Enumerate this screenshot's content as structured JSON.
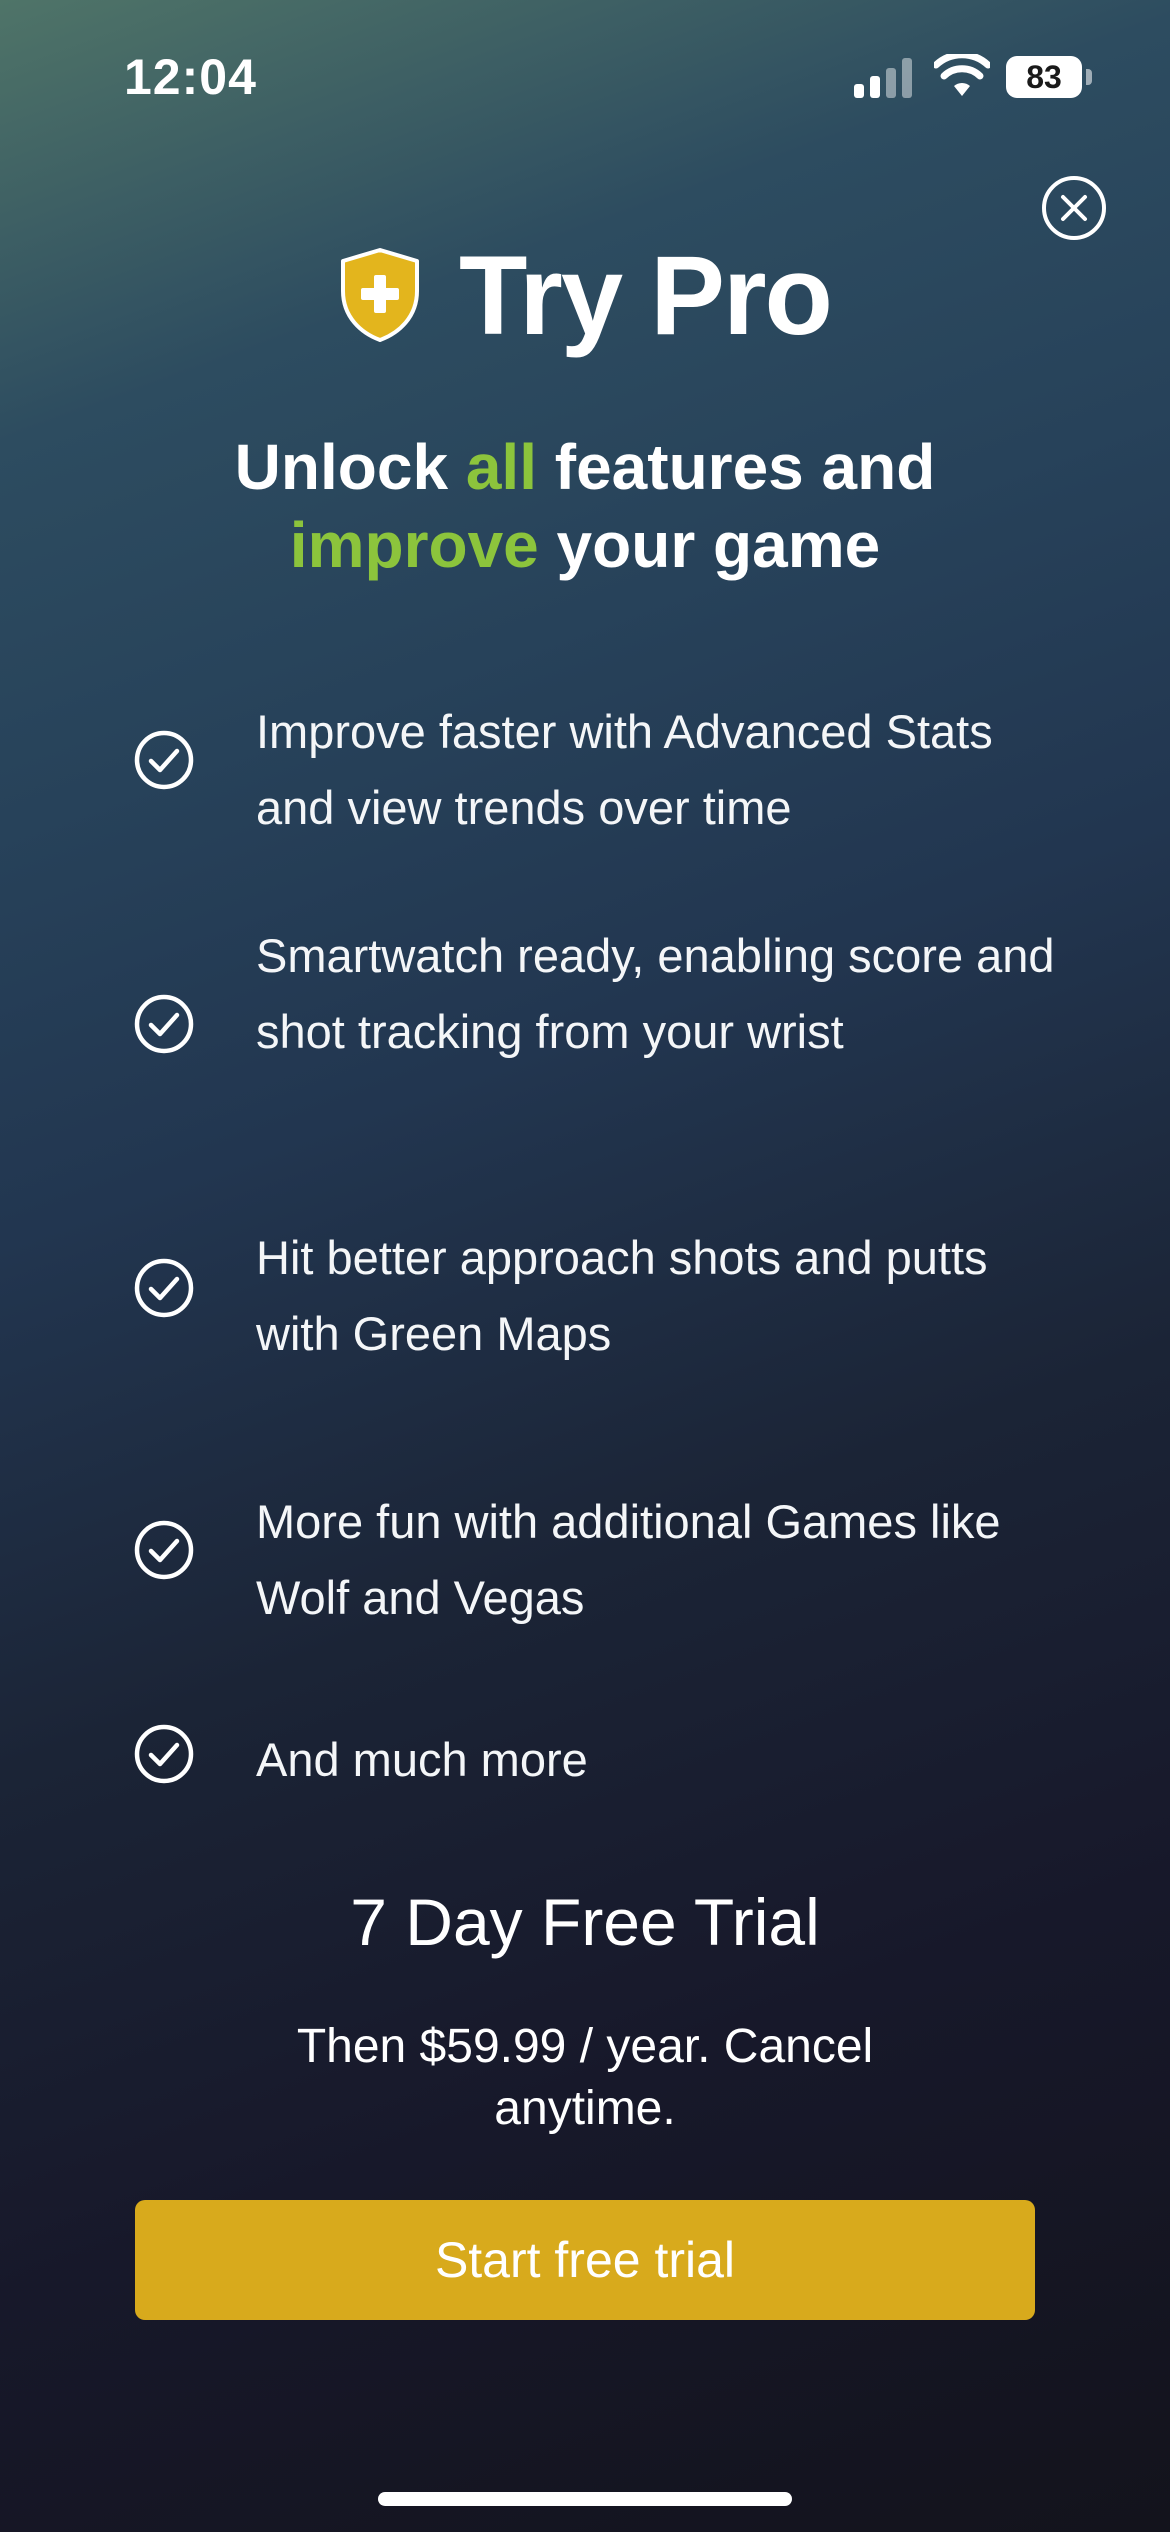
{
  "status_bar": {
    "time": "12:04",
    "battery": "83",
    "icons": [
      "cellular-signal-icon",
      "wifi-icon",
      "battery-icon"
    ]
  },
  "header": {
    "close_icon": "close-circle-icon",
    "brand_icon": "pro-shield-icon",
    "title": "Try Pro"
  },
  "headline": {
    "part1": "Unlock ",
    "part2": "all",
    "part3": " features and",
    "part4": "improve",
    "part5": " your game"
  },
  "features": [
    {
      "icon": "check-circle-icon",
      "text": "Improve faster with Advanced Stats and view trends over time"
    },
    {
      "icon": "check-circle-icon",
      "text": "Smartwatch ready, enabling score and shot tracking from your wrist"
    },
    {
      "icon": "check-circle-icon",
      "text": "Hit better approach shots and putts with Green Maps"
    },
    {
      "icon": "check-circle-icon",
      "text": "More fun with additional Games like Wolf and Vegas"
    },
    {
      "icon": "check-circle-icon",
      "text": "And much more"
    }
  ],
  "trial": {
    "title": "7 Day Free Trial",
    "subtitle": "Then $59.99 / year. Cancel anytime."
  },
  "cta": {
    "label": "Start free trial"
  },
  "colors": {
    "accent_green": "#8cc43c",
    "cta_gold": "#d8aa1c",
    "shield_gold": "#e3b51d",
    "text": "#ffffff"
  }
}
